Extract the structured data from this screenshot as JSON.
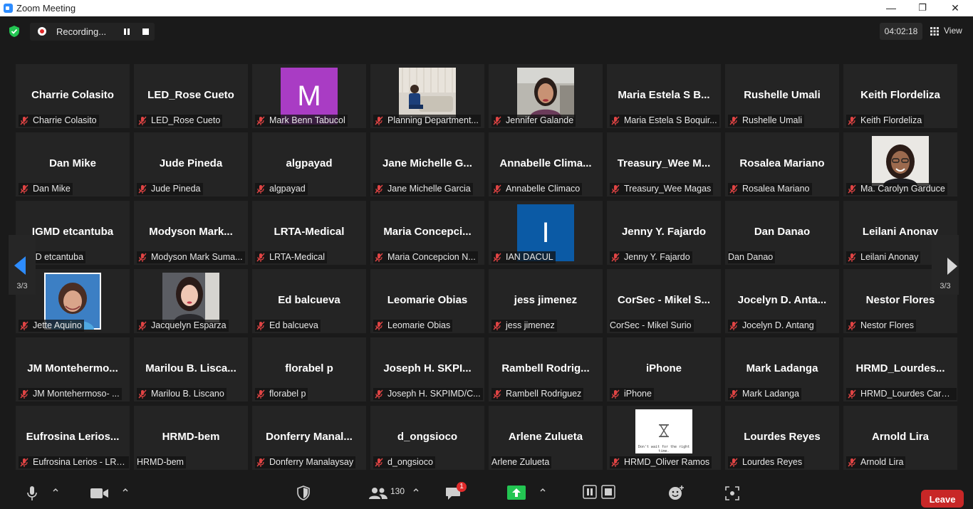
{
  "window": {
    "title": "Zoom Meeting",
    "minimize": "—",
    "maximize": "❐",
    "close": "✕"
  },
  "recording": {
    "label": "Recording..."
  },
  "timer": "04:02:18",
  "view_label": "View",
  "pagination": {
    "left": "3/3",
    "right": "3/3"
  },
  "tiles": [
    {
      "big": "Charrie Colasito",
      "name": "Charrie Colasito",
      "muted": true
    },
    {
      "big": "LED_Rose Cueto",
      "name": "LED_Rose Cueto",
      "muted": true
    },
    {
      "avatar": "M",
      "avatar_color": "#a93cc4",
      "name": "Mark Benn Tabucol",
      "muted": true
    },
    {
      "photo": "room",
      "name": "Planning Department...",
      "muted": true
    },
    {
      "photo": "woman-office",
      "name": "Jennifer Galande",
      "muted": true
    },
    {
      "big": "Maria Estela S B...",
      "name": "Maria Estela S Boquir...",
      "muted": true
    },
    {
      "big": "Rushelle Umali",
      "name": "Rushelle Umali",
      "muted": true
    },
    {
      "big": "Keith Flordeliza",
      "name": "Keith Flordeliza",
      "muted": true
    },
    {
      "big": "Dan Mike",
      "name": "Dan Mike",
      "muted": true
    },
    {
      "big": "Jude Pineda",
      "name": "Jude Pineda",
      "muted": true
    },
    {
      "big": "algpayad",
      "name": "algpayad",
      "muted": true
    },
    {
      "big": "Jane Michelle G...",
      "name": "Jane Michelle Garcia",
      "muted": true
    },
    {
      "big": "Annabelle Clima...",
      "name": "Annabelle Climaco",
      "muted": true
    },
    {
      "big": "Treasury_Wee M...",
      "name": "Treasury_Wee Magas",
      "muted": true
    },
    {
      "big": "Rosalea Mariano",
      "name": "Rosalea Mariano",
      "muted": true
    },
    {
      "photo": "woman-glasses",
      "name": "Ma. Carolyn Garduce",
      "muted": true
    },
    {
      "big": "IGMD etcantuba",
      "name": "IGMD etcantuba",
      "muted": false
    },
    {
      "big": "Modyson Mark...",
      "name": "Modyson Mark Suma...",
      "muted": true
    },
    {
      "big": "LRTA-Medical",
      "name": "LRTA-Medical",
      "muted": true
    },
    {
      "big": "Maria Concepci...",
      "name": "Maria Concepcion N...",
      "muted": true
    },
    {
      "avatar": "I",
      "avatar_color": "#0b5aa5",
      "name": "IAN DACUL",
      "muted": true
    },
    {
      "big": "Jenny Y. Fajardo",
      "name": "Jenny Y. Fajardo",
      "muted": true
    },
    {
      "big": "Dan Danao",
      "name": "Dan Danao",
      "muted": false
    },
    {
      "big": "Leilani Anonay",
      "name": "Leilani Anonay",
      "muted": true
    },
    {
      "photo": "woman-blue",
      "name": "Jette Aquino",
      "muted": true
    },
    {
      "photo": "woman-car",
      "name": "Jacquelyn Esparza",
      "muted": true
    },
    {
      "big": "Ed balcueva",
      "name": "Ed balcueva",
      "muted": true
    },
    {
      "big": "Leomarie Obias",
      "name": "Leomarie Obias",
      "muted": true
    },
    {
      "big": "jess jimenez",
      "name": "jess jimenez",
      "muted": true
    },
    {
      "big": "CorSec - Mikel S...",
      "name": "CorSec - Mikel Surio",
      "muted": false
    },
    {
      "big": "Jocelyn D. Anta...",
      "name": "Jocelyn D. Antang",
      "muted": true
    },
    {
      "big": "Nestor Flores",
      "name": "Nestor Flores",
      "muted": true
    },
    {
      "big": "JM Montehermo...",
      "name": "JM Montehermoso- ...",
      "muted": true
    },
    {
      "big": "Marilou B. Lisca...",
      "name": "Marilou B. Liscano",
      "muted": true
    },
    {
      "big": "florabel p",
      "name": "florabel p",
      "muted": true
    },
    {
      "big": "Joseph H. SKPI...",
      "name": "Joseph H. SKPIMD/C...",
      "muted": true
    },
    {
      "big": "Rambell Rodrig...",
      "name": "Rambell Rodriguez",
      "muted": true
    },
    {
      "big": "iPhone",
      "name": "iPhone",
      "muted": true
    },
    {
      "big": "Mark Ladanga",
      "name": "Mark Ladanga",
      "muted": true
    },
    {
      "big": "HRMD_Lourdes...",
      "name": "HRMD_Lourdes Caraan",
      "muted": true
    },
    {
      "big": "Eufrosina Lerios...",
      "name": "Eufrosina Lerios - LRTA",
      "muted": true
    },
    {
      "big": "HRMD-bem",
      "name": "HRMD-bem",
      "muted": false
    },
    {
      "big": "Donferry Manal...",
      "name": "Donferry Manalaysay",
      "muted": true
    },
    {
      "big": "d_ongsioco",
      "name": "d_ongsioco",
      "muted": true
    },
    {
      "big": "Arlene Zulueta",
      "name": "Arlene Zulueta",
      "muted": false
    },
    {
      "photo": "hourglass",
      "photo_caption": "Don't wait for the right time.",
      "name": "HRMD_Oliver Ramos",
      "muted": true
    },
    {
      "big": "Lourdes Reyes",
      "name": "Lourdes Reyes",
      "muted": true
    },
    {
      "big": "Arnold Lira",
      "name": "Arnold Lira",
      "muted": true
    }
  ],
  "toolbar": {
    "participants_count": "130",
    "chat_badge": "1",
    "leave_label": "Leave"
  },
  "colors": {
    "accent_green": "#23c552",
    "leave_red": "#c82727",
    "muted_red": "#e04444"
  }
}
